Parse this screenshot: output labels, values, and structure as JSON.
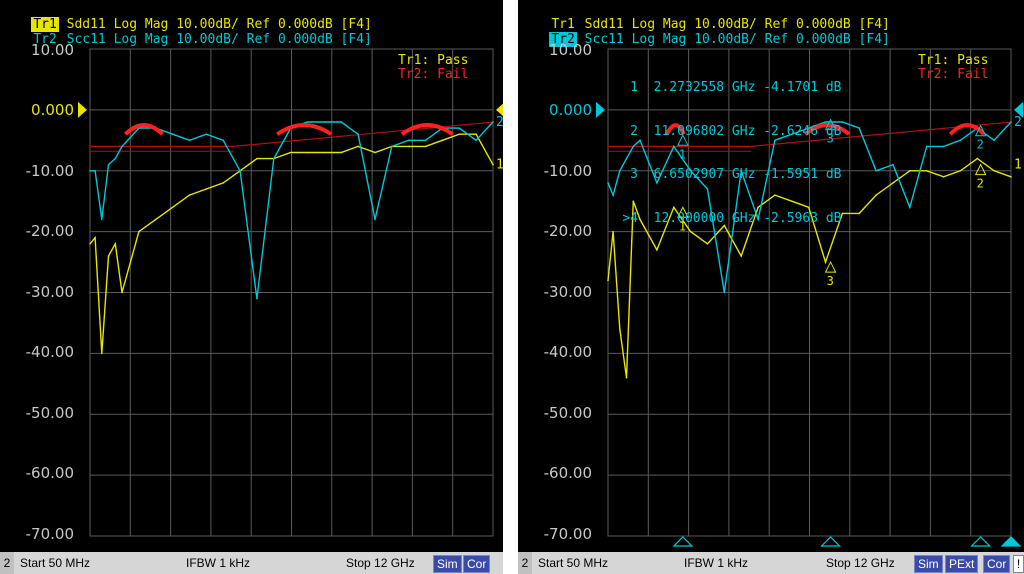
{
  "colors": {
    "tr1": "#e6e600",
    "tr2": "#00c8d8",
    "fail": "#ff2020",
    "grid": "#5a5a5a",
    "label": "#c8c8c8"
  },
  "left": {
    "hdr1": {
      "tag": "Tr1",
      "text": " Sdd11 Log Mag 10.00dB/ Ref 0.000dB [F4]"
    },
    "hdr2": {
      "tag": "Tr2",
      "text": " Scc11 Log Mag 10.00dB/ Ref 0.000dB [F4]"
    },
    "legend1": "Tr1: Pass",
    "legend2": "Tr2: Fail",
    "ref_value": "0.000",
    "status": {
      "channel": "2",
      "start": "Start 50 MHz",
      "ifbw": "IFBW 1 kHz",
      "stop": "Stop 12 GHz",
      "b1": "Sim",
      "b2": "Cor"
    }
  },
  "right": {
    "hdr1": {
      "tag": "Tr1",
      "text": " Sdd11 Log Mag 10.00dB/ Ref 0.000dB [F4]"
    },
    "hdr2": {
      "tag": "Tr2",
      "text": " Scc11 Log Mag 10.00dB/ Ref 0.000dB [F4]"
    },
    "legend1": "Tr1: Pass",
    "legend2": "Tr2: Fail",
    "ref_value": "0.000",
    "markers": [
      {
        "id": "1",
        "freq": "2.2732558 GHz",
        "val": "-4.1701 dB"
      },
      {
        "id": "2",
        "freq": "11.096802 GHz",
        "val": "-2.6246 dB"
      },
      {
        "id": "3",
        "freq": "6.6502907 GHz",
        "val": "-1.5951 dB"
      },
      {
        "id": ">4",
        "freq": "12.000000 GHz",
        "val": "-2.5963 dB"
      }
    ],
    "status": {
      "channel": "2",
      "start": "Start 50 MHz",
      "ifbw": "IFBW 1 kHz",
      "stop": "Stop 12 GHz",
      "b1": "Sim",
      "b2": "PExt",
      "b3": "Cor",
      "b4": "!"
    }
  },
  "y_labels": [
    "10.00",
    "0.000",
    "-10.00",
    "-20.00",
    "-30.00",
    "-40.00",
    "-50.00",
    "-60.00",
    "-70.00"
  ],
  "chart_data": [
    {
      "type": "line",
      "xlim_ghz": [
        0.05,
        12
      ],
      "ylim_db": [
        -70,
        10
      ],
      "y_ticks": [
        10,
        0,
        -10,
        -20,
        -30,
        -40,
        -50,
        -60,
        -70
      ],
      "series": [
        {
          "name": "Tr1",
          "x": [
            0.05,
            0.2,
            0.4,
            0.6,
            0.8,
            1.0,
            1.5,
            2.0,
            2.5,
            3.0,
            3.5,
            4.0,
            4.5,
            5.0,
            5.5,
            6.0,
            6.5,
            7.0,
            7.5,
            8.0,
            8.5,
            9.0,
            9.5,
            10.0,
            10.5,
            11.0,
            11.5,
            12.0
          ],
          "y": [
            -22,
            -21,
            -40,
            -24,
            -22,
            -30,
            -20,
            -18,
            -16,
            -14,
            -13,
            -12,
            -10,
            -8,
            -8,
            -7,
            -7,
            -7,
            -7,
            -6,
            -7,
            -6,
            -6,
            -6,
            -5,
            -4,
            -4,
            -9
          ]
        },
        {
          "name": "Tr2",
          "x": [
            0.05,
            0.2,
            0.4,
            0.6,
            0.8,
            1.0,
            1.5,
            2.0,
            2.5,
            3.0,
            3.5,
            4.0,
            4.5,
            5.0,
            5.5,
            6.0,
            6.5,
            7.0,
            7.5,
            8.0,
            8.5,
            9.0,
            9.5,
            10.0,
            10.5,
            11.0,
            11.5,
            12.0
          ],
          "y": [
            -10,
            -10,
            -18,
            -9,
            -8,
            -6,
            -3,
            -3,
            -4,
            -5,
            -4,
            -5,
            -10,
            -31,
            -8,
            -3,
            -2,
            -2,
            -2,
            -4,
            -18,
            -6,
            -5,
            -5,
            -3,
            -3,
            -5,
            -2
          ]
        }
      ]
    },
    {
      "type": "line",
      "xlim_ghz": [
        0.05,
        12
      ],
      "ylim_db": [
        -70,
        10
      ],
      "y_ticks": [
        10,
        0,
        -10,
        -20,
        -30,
        -40,
        -50,
        -60,
        -70
      ],
      "series": [
        {
          "name": "Tr1",
          "x": [
            0.05,
            0.2,
            0.4,
            0.6,
            0.8,
            1.0,
            1.5,
            2.0,
            2.5,
            3.0,
            3.5,
            4.0,
            4.5,
            5.0,
            5.5,
            6.0,
            6.5,
            7.0,
            7.5,
            8.0,
            8.5,
            9.0,
            9.5,
            10.0,
            10.5,
            11.0,
            11.5,
            12.0
          ],
          "y": [
            -28,
            -20,
            -36,
            -44,
            -15,
            -18,
            -23,
            -16,
            -20,
            -22,
            -19,
            -24,
            -16,
            -14,
            -15,
            -16,
            -25,
            -17,
            -17,
            -14,
            -12,
            -10,
            -10,
            -11,
            -10,
            -8,
            -10,
            -11
          ]
        },
        {
          "name": "Tr2",
          "x": [
            0.05,
            0.2,
            0.4,
            0.6,
            0.8,
            1.0,
            1.5,
            2.0,
            2.5,
            3.0,
            3.5,
            4.0,
            4.5,
            5.0,
            5.5,
            6.0,
            6.5,
            7.0,
            7.5,
            8.0,
            8.5,
            9.0,
            9.5,
            10.0,
            10.5,
            11.0,
            11.5,
            12.0
          ],
          "y": [
            -12,
            -14,
            -10,
            -8,
            -6,
            -5,
            -12,
            -6,
            -10,
            -13,
            -30,
            -10,
            -18,
            -5,
            -4,
            -3,
            -2,
            -2,
            -3,
            -10,
            -9,
            -16,
            -6,
            -6,
            -5,
            -3,
            -5,
            -2
          ]
        }
      ]
    }
  ]
}
